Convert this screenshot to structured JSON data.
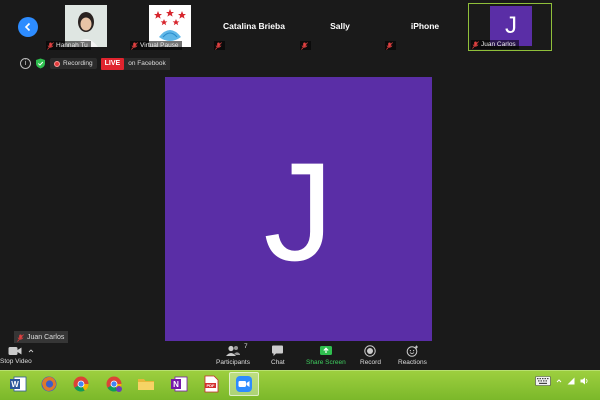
{
  "participants_strip": [
    {
      "name": "Hannah Tu",
      "muted": true,
      "has_photo": true
    },
    {
      "name": "Virtual Pause",
      "muted": true,
      "has_photo": true
    },
    {
      "name": "Catalina Brieba",
      "muted": true,
      "has_photo": false
    },
    {
      "name": "Sally",
      "muted": true,
      "has_photo": false
    },
    {
      "name": "iPhone",
      "muted": true,
      "has_photo": false
    },
    {
      "name": "Juan Carlos",
      "muted": true,
      "has_photo": false,
      "avatar_letter": "J",
      "active": true
    }
  ],
  "status": {
    "recording_label": "Recording",
    "live_badge": "LIVE",
    "live_text": "on Facebook"
  },
  "main_video": {
    "avatar_letter": "J",
    "speaker_name": "Juan Carlos",
    "avatar_color": "#5a2ea6"
  },
  "toolbar": {
    "stop_video": "Stop Video",
    "participants": "Participants",
    "participants_count": "7",
    "chat": "Chat",
    "share_screen": "Share Screen",
    "record": "Record",
    "reactions": "Reactions"
  },
  "taskbar": {
    "apps": [
      "word-icon",
      "firefox-icon",
      "chrome-icon",
      "chrome-alt-icon",
      "file-explorer-icon",
      "onenote-icon",
      "pdf-icon",
      "zoom-icon"
    ],
    "active_app": "zoom-icon"
  },
  "colors": {
    "accent_blue": "#2d8cff",
    "share_green": "#3fcf5f",
    "live_red": "#e0242e",
    "taskbar_green": "#8dc63f"
  }
}
